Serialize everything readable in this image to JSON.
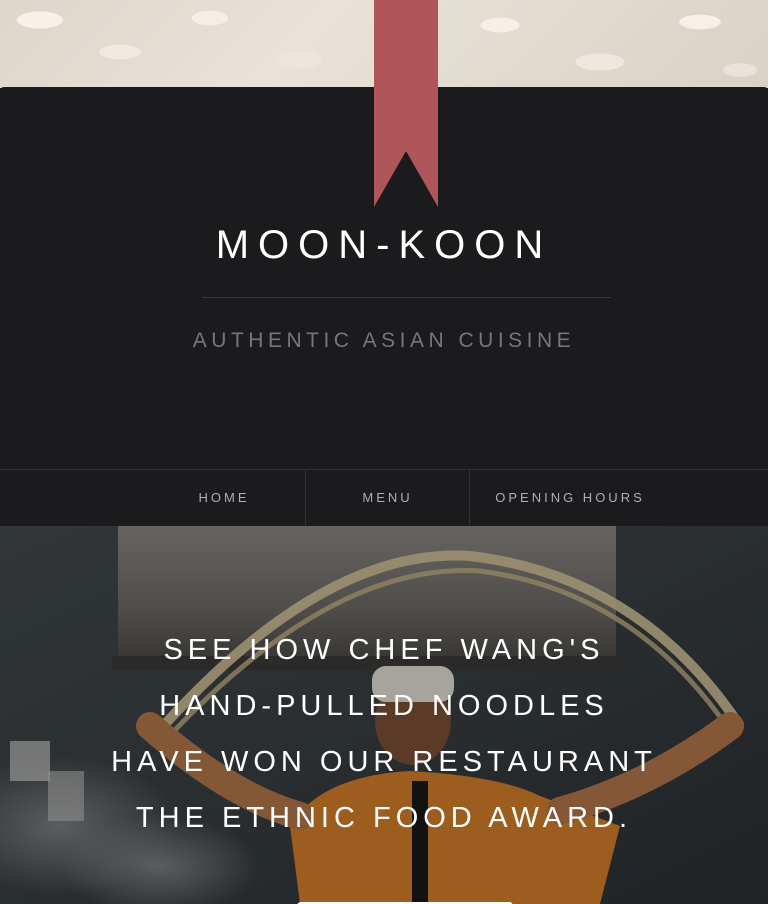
{
  "brand": {
    "title": "MOON-KOON",
    "tagline": "AUTHENTIC ASIAN CUISINE",
    "accent_color": "#b0565b",
    "ribbon_icon": "bookmark-ribbon-icon"
  },
  "nav": {
    "items": [
      {
        "label": "HOME"
      },
      {
        "label": "MENU"
      },
      {
        "label": "OPENING HOURS"
      }
    ]
  },
  "hero": {
    "lines": [
      "SEE HOW CHEF WANG'S",
      "HAND-PULLED NOODLES",
      "HAVE WON OUR RESTAURANT",
      "THE ETHNIC FOOD AWARD."
    ],
    "image": "chef-pulling-noodles-photo"
  },
  "colors": {
    "header_bg": "#1b1a1c",
    "text_primary": "#ffffff",
    "text_muted": "#78767a"
  }
}
